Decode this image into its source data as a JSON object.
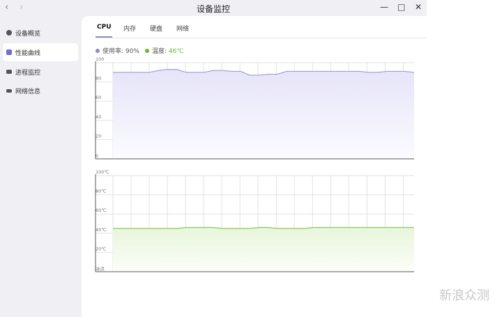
{
  "window": {
    "title": "设备监控",
    "back": "‹",
    "forward": "›",
    "minimize": "—",
    "maximize": "□",
    "close": "✕"
  },
  "sidebar": {
    "items": [
      {
        "label": "设备概览",
        "icon": "overview-icon"
      },
      {
        "label": "性能曲线",
        "icon": "chart-icon",
        "active": true
      },
      {
        "label": "进程监控",
        "icon": "process-icon"
      },
      {
        "label": "网络信息",
        "icon": "network-icon"
      }
    ]
  },
  "tabs": [
    {
      "label": "CPU",
      "active": true
    },
    {
      "label": "内存"
    },
    {
      "label": "硬盘"
    },
    {
      "label": "网络"
    }
  ],
  "legend": {
    "usage_label": "使用率: ",
    "usage_value": "90%",
    "temp_label": "温度: ",
    "temp_value": "46℃",
    "usage_color": "#8a87d6",
    "temp_color": "#6ab82e"
  },
  "watermark": "新浪众测",
  "chart_data": [
    {
      "type": "area",
      "title": "CPU使用率",
      "ylim": [
        0,
        100
      ],
      "yticks": [
        "0",
        "20",
        "40",
        "60",
        "80",
        "100"
      ],
      "color": "#a09cd8",
      "values": [
        90,
        90,
        90,
        90,
        90,
        92,
        93,
        93,
        90,
        90,
        90,
        92,
        92,
        91,
        91,
        87,
        87,
        88,
        88,
        91,
        91,
        91,
        91,
        91,
        91,
        91,
        91,
        91,
        90,
        90,
        91,
        91,
        91,
        90
      ]
    },
    {
      "type": "area",
      "title": "CPU温度",
      "ylim": [
        0,
        100
      ],
      "yticks": [
        "冰点",
        "20℃",
        "40℃",
        "60℃",
        "80℃",
        "100℃"
      ],
      "color": "#8cc65a",
      "values": [
        45,
        45,
        45,
        45,
        45,
        45,
        45,
        45,
        46,
        46,
        46,
        46,
        45,
        45,
        45,
        45,
        46,
        46,
        45,
        45,
        45,
        45,
        46,
        46,
        46,
        46,
        46,
        46,
        46,
        46,
        46,
        46,
        46,
        46
      ]
    }
  ]
}
